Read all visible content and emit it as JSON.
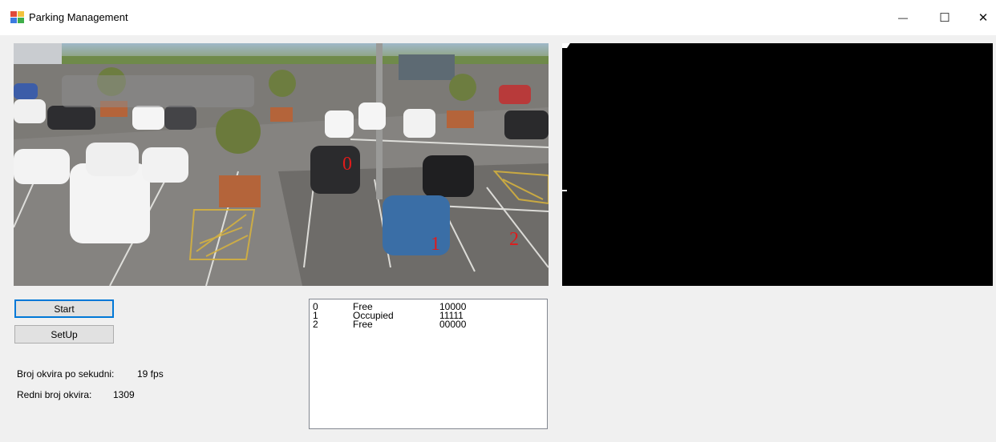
{
  "window": {
    "title": "Parking Management",
    "minimize_glyph": "—",
    "maximize_glyph": "☐",
    "close_glyph": "✕"
  },
  "camera": {
    "spot_labels": [
      "0",
      "1",
      "2"
    ],
    "spot_color": "#e01b1b"
  },
  "controls": {
    "start_label": "Start",
    "setup_label": "SetUp"
  },
  "stats": {
    "fps_label": "Broj okvira po sekudni:",
    "fps_value": "19 fps",
    "frame_label": "Redni broj okvira:",
    "frame_value": "1309"
  },
  "spots": [
    {
      "id": "0",
      "status": "Free",
      "history": "10000"
    },
    {
      "id": "1",
      "status": "Occupied",
      "history": "11111"
    },
    {
      "id": "2",
      "status": "Free",
      "history": "00000"
    }
  ]
}
